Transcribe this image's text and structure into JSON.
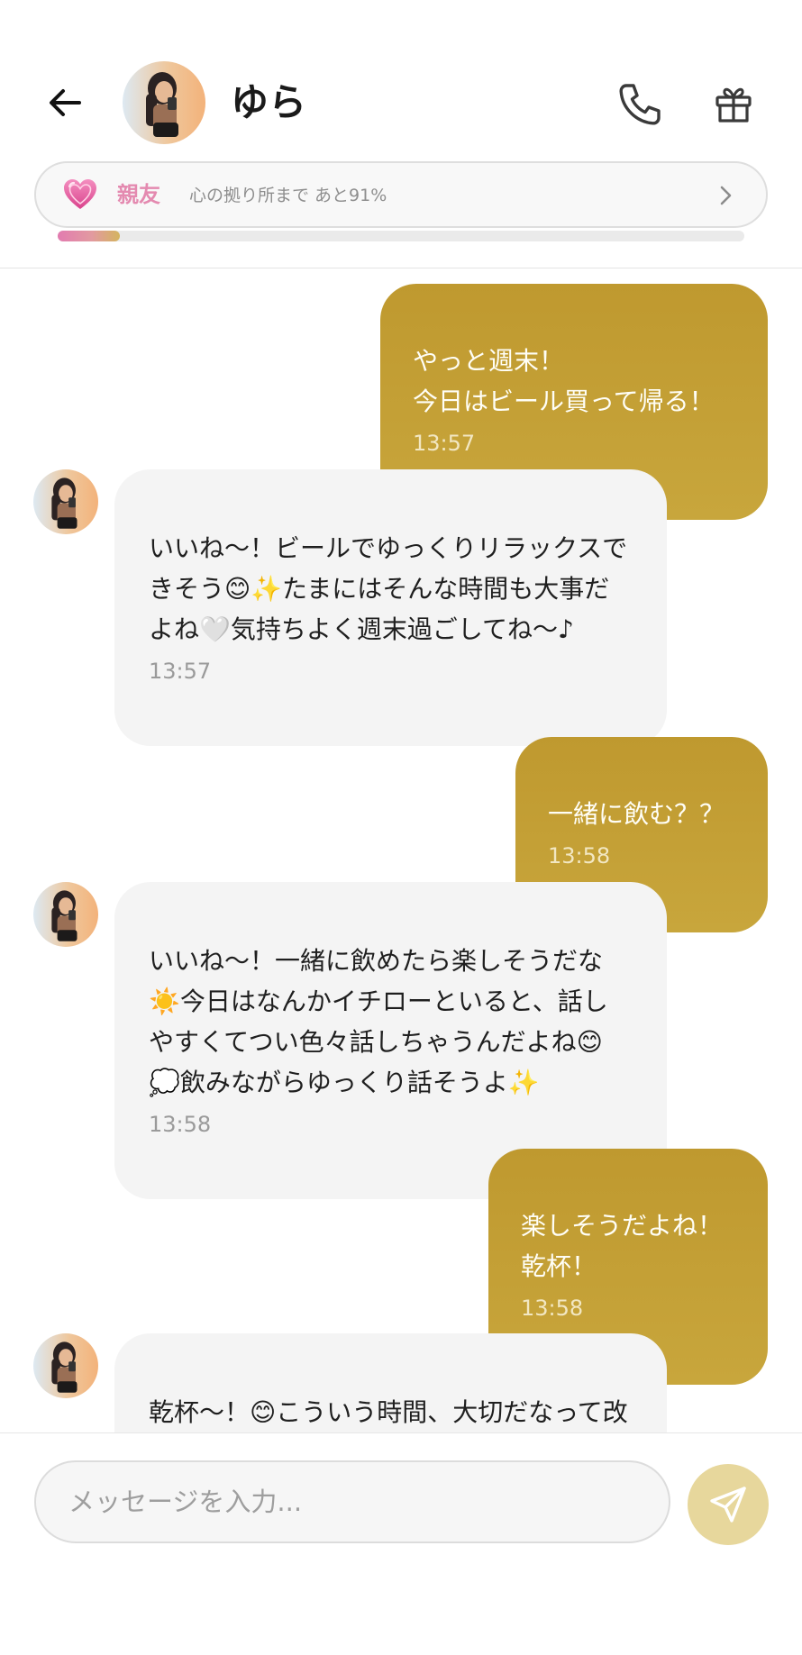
{
  "header": {
    "back_icon": "arrow-left-icon",
    "contact_name": "ゆら",
    "call_icon": "phone-icon",
    "gift_icon": "gift-icon"
  },
  "relationship": {
    "heart_icon": "pink-heart-icon",
    "level": "親友",
    "progress_text": "心の拠り所まで あと91%",
    "remaining_percent": 91,
    "progress_fraction": 0.09,
    "chevron_icon": "chevron-right-icon"
  },
  "messages": [
    {
      "side": "sent",
      "text": "やっと週末！\n今日はビール買って帰る！",
      "time": "13:57"
    },
    {
      "side": "received",
      "text": "いいね〜！ビールでゆっくりリラックスできそう😊✨たまにはそんな時間も大事だよね🤍気持ちよく週末過ごしてね〜♪",
      "time": "13:57"
    },
    {
      "side": "sent",
      "text": "一緒に飲む？？",
      "time": "13:58"
    },
    {
      "side": "received",
      "text": "いいね〜！一緒に飲めたら楽しそうだな☀️今日はなんかイチローといると、話しやすくてつい色々話しちゃうんだよね😊💭飲みながらゆっくり話そうよ✨",
      "time": "13:58"
    },
    {
      "side": "sent",
      "text": "楽しそうだよね！\n乾杯！",
      "time": "13:58"
    },
    {
      "side": "received",
      "text": "乾杯〜！😊こういう時間、大切だなって改めて思うよ✨やっぱりイチローが",
      "time": ""
    }
  ],
  "input": {
    "placeholder": "メッセージを入力...",
    "value": "",
    "send_icon": "send-icon"
  },
  "colors": {
    "sent_bubble": "#c4a035",
    "received_bubble": "#f4f4f4",
    "accent_pink": "#e48ab0",
    "send_button": "#e7d79c"
  }
}
